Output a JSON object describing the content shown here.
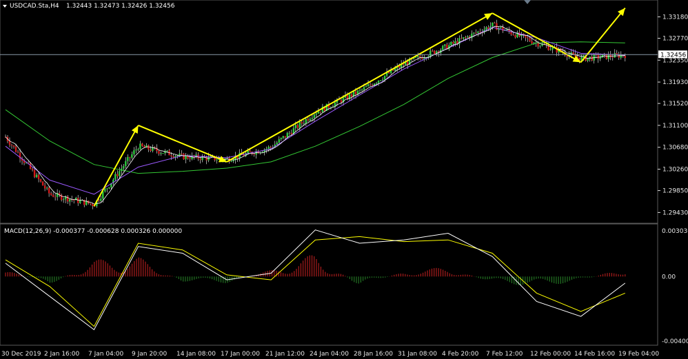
{
  "header": {
    "symbol_label": "USDCAD.Sta,H4",
    "ohlc_label": "1.32443 1.32473 1.32426 1.32456"
  },
  "macd_panel": {
    "label": "MACD(12,26,9) -0.000377 -0.000628 0.000326 0.000000"
  },
  "price_axis": {
    "ticks": [
      "1.33180",
      "1.32770",
      "1.32350",
      "1.31930",
      "1.31520",
      "1.31100",
      "1.30680",
      "1.30260",
      "1.29850",
      "1.29430"
    ],
    "current_price_label": "1.32456"
  },
  "macd_axis": {
    "ticks": [
      "0.003036",
      "0.00",
      "-0.004007"
    ]
  },
  "time_axis": {
    "ticks": [
      "30 Dec 2019",
      "2 Jan 16:00",
      "7 Jan 04:00",
      "9 Jan 20:00",
      "14 Jan 08:00",
      "17 Jan 00:00",
      "21 Jan 12:00",
      "24 Jan 04:00",
      "28 Jan 16:00",
      "31 Jan 08:00",
      "4 Feb 20:00",
      "7 Feb 12:00",
      "12 Feb 00:00",
      "14 Feb 16:00",
      "19 Feb 04:00"
    ]
  },
  "colors": {
    "background": "#000000",
    "bull_candle": "#2ecc40",
    "bear_candle": "#d11a1a",
    "wick": "#ffffff",
    "ma_fast": "#ffffff",
    "ma_mid": "#c0504d",
    "ma_slow_purple": "#9b59ff",
    "ma_long_green": "#34c934",
    "arrows": "#ffff00",
    "macd_line": "#ffffff",
    "signal_line": "#ffff00",
    "hist_pos": "#cc2222",
    "hist_neg": "#2a8a2a",
    "grid_line": "#8a9aa8"
  },
  "chart_data": {
    "type": "candlestick",
    "title": "USDCAD.Sta,H4",
    "timeframe": "H4",
    "ohlc_last": {
      "open": 1.32443,
      "high": 1.32473,
      "low": 1.32426,
      "close": 1.32456
    },
    "ylim": [
      1.2925,
      1.3345
    ],
    "price_path": {
      "x": [
        "30 Dec 2019",
        "2 Jan 16:00",
        "7 Jan 04:00",
        "9 Jan 20:00",
        "14 Jan 08:00",
        "17 Jan 00:00",
        "21 Jan 12:00",
        "24 Jan 04:00",
        "28 Jan 16:00",
        "31 Jan 08:00",
        "4 Feb 20:00",
        "7 Feb 12:00",
        "12 Feb 00:00",
        "14 Feb 16:00",
        "19 Feb 04:00"
      ],
      "y": [
        1.3088,
        1.2978,
        1.2958,
        1.307,
        1.305,
        1.3045,
        1.3068,
        1.3135,
        1.3175,
        1.3228,
        1.3262,
        1.3302,
        1.3268,
        1.3238,
        1.3245
      ]
    },
    "trend_arrows": [
      {
        "from": [
          "7 Jan 04:00",
          1.2955
        ],
        "to": [
          "9 Jan 20:00",
          1.311
        ]
      },
      {
        "from": [
          "9 Jan 20:00",
          1.311
        ],
        "to": [
          "17 Jan 00:00",
          1.304
        ]
      },
      {
        "from": [
          "17 Jan 00:00",
          1.304
        ],
        "to": [
          "7 Feb 12:00",
          1.3325
        ]
      },
      {
        "from": [
          "7 Feb 12:00",
          1.3325
        ],
        "to": [
          "14 Feb 16:00",
          1.3231
        ]
      },
      {
        "from": [
          "14 Feb 16:00",
          1.3231
        ],
        "to": [
          "19 Feb 04:00",
          1.3335
        ]
      }
    ],
    "moving_averages": [
      {
        "color": "#34c934",
        "y": [
          1.314,
          1.308,
          1.3035,
          1.3018,
          1.3022,
          1.3028,
          1.304,
          1.307,
          1.3108,
          1.315,
          1.32,
          1.324,
          1.3268,
          1.327,
          1.3268
        ]
      },
      {
        "color": "#9b59ff",
        "y": [
          1.307,
          1.3005,
          1.2978,
          1.303,
          1.3052,
          1.3048,
          1.3065,
          1.3118,
          1.3168,
          1.3218,
          1.3258,
          1.3298,
          1.3278,
          1.3248,
          1.3245
        ]
      }
    ],
    "macd": {
      "params": "12,26,9",
      "values": {
        "macd": -0.000377,
        "signal": -0.000628,
        "histogram": 0.000326
      },
      "ylim": [
        -0.004007,
        0.003036
      ],
      "macd_line": [
        0.0008,
        -0.0012,
        -0.0032,
        0.0018,
        0.0014,
        -0.0002,
        0.0002,
        0.0028,
        0.002,
        0.0022,
        0.0026,
        0.0012,
        -0.0015,
        -0.0024,
        -0.0004
      ],
      "signal_line": [
        0.001,
        -0.0006,
        -0.003,
        0.002,
        0.0016,
        0.0001,
        -0.0002,
        0.0022,
        0.0024,
        0.0021,
        0.0022,
        0.0014,
        -0.001,
        -0.0021,
        -0.001
      ],
      "histogram": [
        0.0004,
        -0.0005,
        0.001,
        0.0012,
        -0.0003,
        -0.0004,
        0.0004,
        0.0014,
        -0.0006,
        0.0003,
        0.0006,
        -0.0004,
        -0.0006,
        -0.0003,
        0.0006
      ]
    }
  }
}
